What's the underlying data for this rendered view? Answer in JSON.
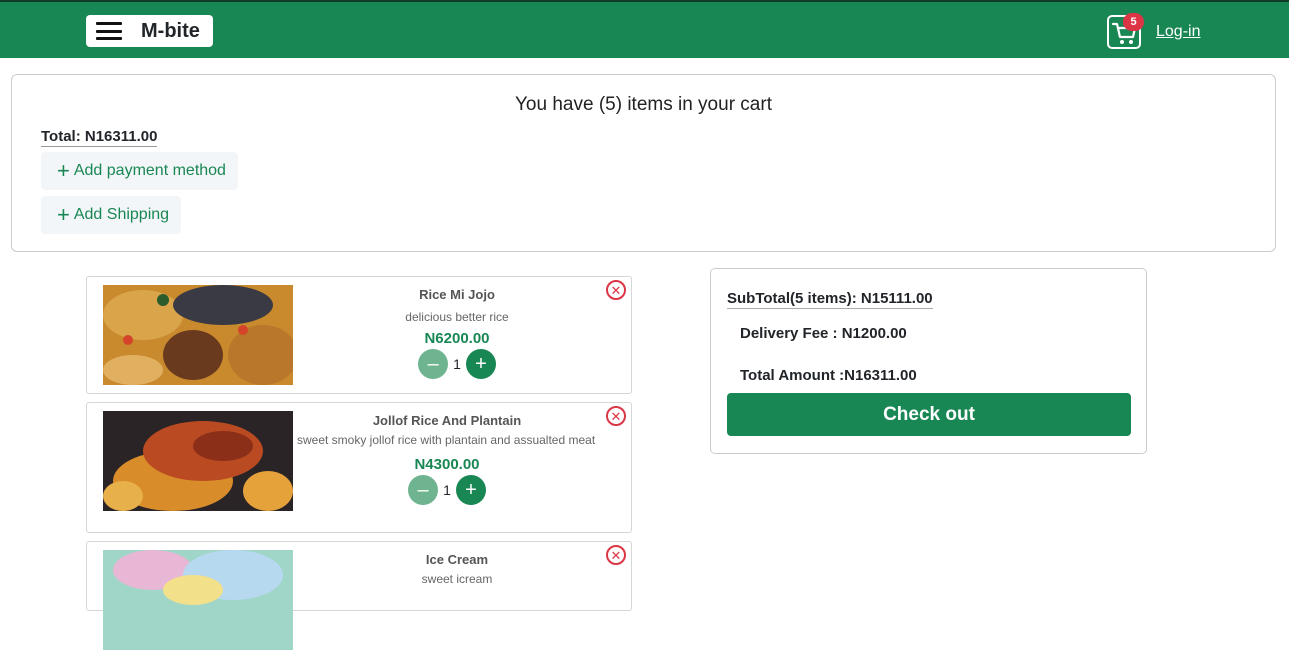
{
  "navbar": {
    "brand": "M-bite",
    "cart_count": "5",
    "login_label": "Log-in",
    "bg_color": "#198754"
  },
  "summary": {
    "title": "You have (5) items in your cart",
    "total": "Total: N16311.00",
    "add_payment_label": "Add payment method",
    "add_shipping_label": "Add Shipping"
  },
  "cart_items": [
    {
      "name": "Rice Mi Jojo",
      "description": "delicious better rice",
      "price": "N6200.00",
      "quantity": "1"
    },
    {
      "name": "Jollof Rice And Plantain",
      "description": "sweet smoky jollof rice with plantain and assualted meat",
      "price": "N4300.00",
      "quantity": "1"
    },
    {
      "name": "Ice Cream",
      "description": "sweet icream"
    }
  ],
  "totals": {
    "subtotal": "SubTotal(5 items): N15111.00",
    "delivery_fee": "Delivery Fee : N1200.00",
    "total_amount": "Total Amount :N16311.00",
    "checkout_label": "Check out"
  },
  "icons": {
    "menu": "hamburger-icon",
    "cart": "shopping-cart-icon",
    "add": "plus-icon",
    "remove": "close-circle-icon"
  }
}
